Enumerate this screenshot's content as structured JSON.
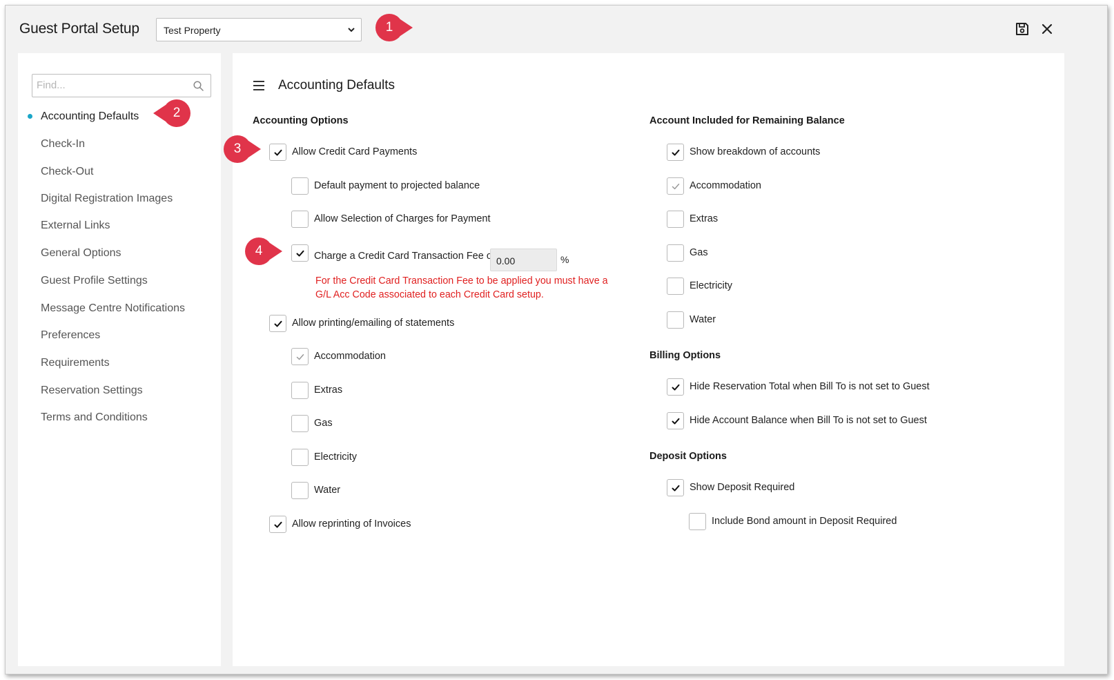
{
  "app": {
    "title": "Guest Portal Setup",
    "property": "Test Property"
  },
  "colors": {
    "accent_dot": "#1aa6c8",
    "badge": "#e0344a",
    "warning": "#e02020"
  },
  "icons": {
    "save": "save-icon",
    "close": "close-icon",
    "search": "search-icon",
    "menu": "hamburger-menu-icon",
    "dropdown": "chevron-down-icon"
  },
  "sidebar": {
    "search_placeholder": "Find...",
    "active_index": 0,
    "items": [
      {
        "label": "Accounting Defaults"
      },
      {
        "label": "Check-In"
      },
      {
        "label": "Check-Out"
      },
      {
        "label": "Digital Registration Images"
      },
      {
        "label": "External Links"
      },
      {
        "label": "General Options"
      },
      {
        "label": "Guest Profile Settings"
      },
      {
        "label": "Message Centre Notifications"
      },
      {
        "label": "Preferences"
      },
      {
        "label": "Requirements"
      },
      {
        "label": "Reservation Settings"
      },
      {
        "label": "Terms and Conditions"
      }
    ]
  },
  "main": {
    "title": "Accounting Defaults",
    "accounting_options": {
      "heading": "Accounting Options",
      "allow_cc": {
        "label": "Allow Credit Card Payments",
        "checked": true
      },
      "default_payment": {
        "label": "Default payment to projected balance",
        "checked": false
      },
      "allow_selection": {
        "label": "Allow Selection of Charges for Payment",
        "checked": false
      },
      "charge_fee": {
        "label": "Charge a Credit Card Transaction Fee of",
        "checked": true,
        "value": "0.00",
        "unit": "%"
      },
      "fee_warning": "For the Credit Card Transaction Fee to be applied you must have a G/L Acc Code associated to each Credit Card setup.",
      "allow_printing": {
        "label": "Allow printing/emailing of statements",
        "checked": true
      },
      "print_accommodation": {
        "label": "Accommodation",
        "checked": true,
        "disabled": true
      },
      "print_extras": {
        "label": "Extras",
        "checked": false
      },
      "print_gas": {
        "label": "Gas",
        "checked": false
      },
      "print_electricity": {
        "label": "Electricity",
        "checked": false
      },
      "print_water": {
        "label": "Water",
        "checked": false
      },
      "allow_reprinting": {
        "label": "Allow reprinting of Invoices",
        "checked": true
      }
    },
    "remaining_balance": {
      "heading": "Account Included for Remaining Balance",
      "show_breakdown": {
        "label": "Show breakdown of accounts",
        "checked": true
      },
      "accommodation": {
        "label": "Accommodation",
        "checked": true,
        "disabled": true
      },
      "extras": {
        "label": "Extras",
        "checked": false
      },
      "gas": {
        "label": "Gas",
        "checked": false
      },
      "electricity": {
        "label": "Electricity",
        "checked": false
      },
      "water": {
        "label": "Water",
        "checked": false
      }
    },
    "billing_options": {
      "heading": "Billing Options",
      "hide_reservation_total": {
        "label": "Hide Reservation Total when Bill To is not set to Guest",
        "checked": true
      },
      "hide_account_balance": {
        "label": "Hide Account Balance when Bill To is not set to Guest",
        "checked": true
      }
    },
    "deposit_options": {
      "heading": "Deposit Options",
      "show_deposit": {
        "label": "Show Deposit Required",
        "checked": true
      },
      "include_bond": {
        "label": "Include Bond amount in Deposit Required",
        "checked": false
      }
    }
  },
  "annotations": [
    "1",
    "2",
    "3",
    "4"
  ]
}
